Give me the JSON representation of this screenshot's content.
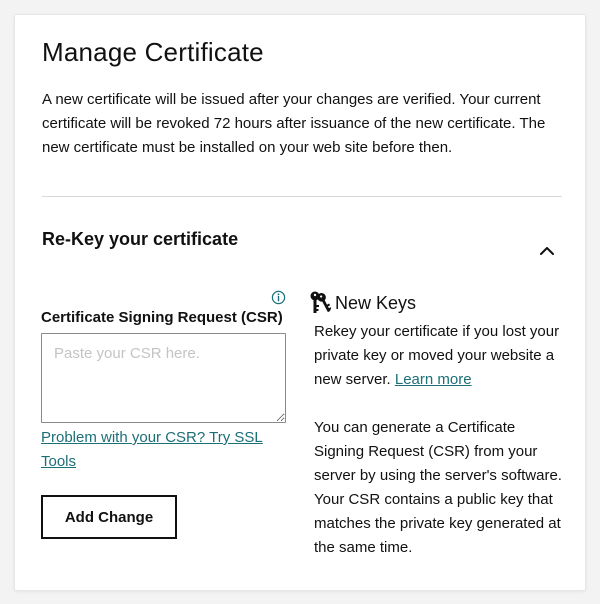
{
  "page": {
    "title": "Manage Certificate",
    "intro": "A new certificate will be issued after your changes are verified. Your current certificate will be revoked 72 hours after issuance of the new certificate. The new certificate must be installed on your web site before then."
  },
  "rekey": {
    "section_title": "Re-Key your certificate",
    "toggle_icon": "chevron-up-icon",
    "csr_label": "Certificate Signing Request (CSR)",
    "csr_info_icon": "info-icon",
    "csr_placeholder": "Paste your CSR here.",
    "csr_value": "",
    "problem_link": "Problem with your CSR? Try SSL Tools",
    "add_button": "Add Change"
  },
  "new_keys": {
    "icon": "keys-icon",
    "title": "New Keys",
    "text_before_link": "Rekey your certificate if you lost your private key or moved your website a new server. ",
    "learn_more": "Learn more",
    "paragraph2": "You can generate a Certificate Signing Request (CSR) from your server by using the server's software. Your CSR contains a public key that matches the private key generated at the same time."
  },
  "colors": {
    "link": "#1b6f77",
    "text": "#111111",
    "divider": "#d8d8d8",
    "background": "#f3f3f3",
    "card": "#ffffff"
  }
}
